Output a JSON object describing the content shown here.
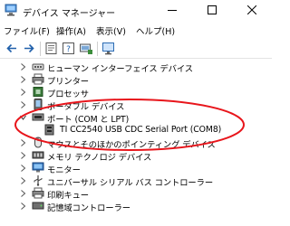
{
  "window": {
    "title": "デバイス マネージャー",
    "app_icon": "device-manager-icon",
    "controls": [
      "minimize-icon",
      "maximize-icon",
      "close-icon"
    ]
  },
  "menu": [
    {
      "label": "ファイル(F)"
    },
    {
      "label": "操作(A)"
    },
    {
      "label": "表示(V)"
    },
    {
      "label": "ヘルプ(H)"
    }
  ],
  "toolbar": {
    "buttons": [
      "back-arrow-icon",
      "forward-arrow-icon",
      "properties-icon",
      "help-icon",
      "driver-icon",
      "monitor-icon"
    ]
  },
  "tree": {
    "items": [
      {
        "label": "ヒューマン インターフェイス デバイス",
        "icon": "hid-icon",
        "expanded": false
      },
      {
        "label": "プリンター",
        "icon": "printer-icon",
        "expanded": false
      },
      {
        "label": "プロセッサ",
        "icon": "processor-icon",
        "expanded": false
      },
      {
        "label": "ポータブル デバイス",
        "icon": "portable-device-icon",
        "expanded": false
      },
      {
        "label": "ポート (COM と LPT)",
        "icon": "port-icon",
        "expanded": true
      },
      {
        "label": "TI CC2540 USB CDC Serial Port (COM8)",
        "icon": "port-icon",
        "child": true
      },
      {
        "label": "マウスとそのほかのポインティング デバイス",
        "icon": "mouse-icon",
        "expanded": false
      },
      {
        "label": "メモリ テクノロジ デバイス",
        "icon": "memory-icon",
        "expanded": false
      },
      {
        "label": "モニター",
        "icon": "monitor-icon",
        "expanded": false
      },
      {
        "label": "ユニバーサル シリアル バス コントローラー",
        "icon": "usb-icon",
        "expanded": false
      },
      {
        "label": "印刷キュー",
        "icon": "print-queue-icon",
        "expanded": false
      },
      {
        "label": "記憶域コントローラー",
        "icon": "storage-controller-icon",
        "expanded": false
      }
    ]
  },
  "annotation": {
    "shape": "ellipse",
    "color": "#e8151b",
    "highlights": "TI CC2540 USB CDC Serial Port (COM8)"
  }
}
